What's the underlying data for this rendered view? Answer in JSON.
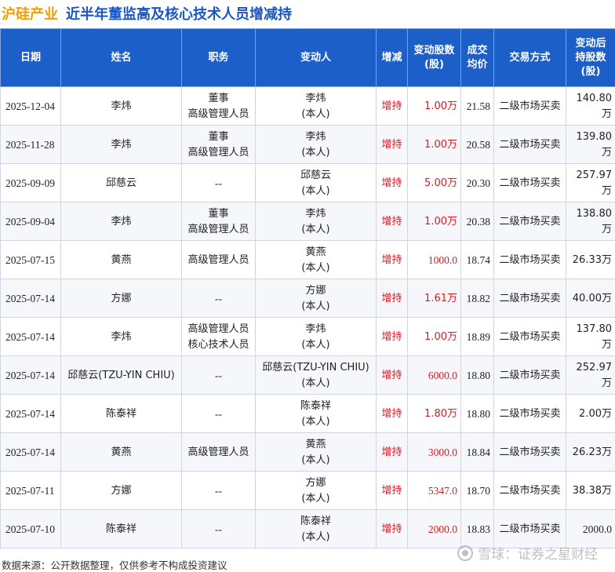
{
  "header": {
    "company": "沪硅产业",
    "subject": "近半年董监高及核心技术人员增减持"
  },
  "table": {
    "columns": [
      "日期",
      "姓名",
      "职务",
      "变动人",
      "增减",
      "变动股数\n(股)",
      "成交\n均价",
      "交易方式",
      "变动后\n持股数\n(股)"
    ],
    "rows": [
      {
        "date": "2025-12-04",
        "name": "李炜",
        "title1": "董事",
        "title2": "高级管理人员",
        "person1": "李炜",
        "person2": "(本人)",
        "dir": "增持",
        "shares": "1.00万",
        "price": "21.58",
        "method": "二级市场买卖",
        "after": "140.80万"
      },
      {
        "date": "2025-11-28",
        "name": "李炜",
        "title1": "董事",
        "title2": "高级管理人员",
        "person1": "李炜",
        "person2": "(本人)",
        "dir": "增持",
        "shares": "1.00万",
        "price": "20.58",
        "method": "二级市场买卖",
        "after": "139.80万"
      },
      {
        "date": "2025-09-09",
        "name": "邱慈云",
        "title1": "--",
        "title2": "",
        "person1": "邱慈云",
        "person2": "(本人)",
        "dir": "增持",
        "shares": "5.00万",
        "price": "20.30",
        "method": "二级市场买卖",
        "after": "257.97万"
      },
      {
        "date": "2025-09-04",
        "name": "李炜",
        "title1": "董事",
        "title2": "高级管理人员",
        "person1": "李炜",
        "person2": "(本人)",
        "dir": "增持",
        "shares": "1.00万",
        "price": "20.38",
        "method": "二级市场买卖",
        "after": "138.80万"
      },
      {
        "date": "2025-07-15",
        "name": "黄燕",
        "title1": "高级管理人员",
        "title2": "",
        "person1": "黄燕",
        "person2": "(本人)",
        "dir": "增持",
        "shares": "1000.0",
        "price": "18.74",
        "method": "二级市场买卖",
        "after": "26.33万"
      },
      {
        "date": "2025-07-14",
        "name": "方娜",
        "title1": "--",
        "title2": "",
        "person1": "方娜",
        "person2": "(本人)",
        "dir": "增持",
        "shares": "1.61万",
        "price": "18.82",
        "method": "二级市场买卖",
        "after": "40.00万"
      },
      {
        "date": "2025-07-14",
        "name": "李炜",
        "title1": "高级管理人员",
        "title2": "核心技术人员",
        "person1": "李炜",
        "person2": "(本人)",
        "dir": "增持",
        "shares": "1.00万",
        "price": "18.89",
        "method": "二级市场买卖",
        "after": "137.80万"
      },
      {
        "date": "2025-07-14",
        "name": "邱慈云(TZU-YIN CHIU)",
        "title1": "--",
        "title2": "",
        "person1": "邱慈云(TZU-YIN CHIU)",
        "person2": "(本人)",
        "dir": "增持",
        "shares": "6000.0",
        "price": "18.80",
        "method": "二级市场买卖",
        "after": "252.97万"
      },
      {
        "date": "2025-07-14",
        "name": "陈泰祥",
        "title1": "--",
        "title2": "",
        "person1": "陈泰祥",
        "person2": "(本人)",
        "dir": "增持",
        "shares": "1.80万",
        "price": "18.80",
        "method": "二级市场买卖",
        "after": "2.00万"
      },
      {
        "date": "2025-07-14",
        "name": "黄燕",
        "title1": "高级管理人员",
        "title2": "",
        "person1": "黄燕",
        "person2": "(本人)",
        "dir": "增持",
        "shares": "3000.0",
        "price": "18.84",
        "method": "二级市场买卖",
        "after": "26.23万"
      },
      {
        "date": "2025-07-11",
        "name": "方娜",
        "title1": "--",
        "title2": "",
        "person1": "方娜",
        "person2": "(本人)",
        "dir": "增持",
        "shares": "5347.0",
        "price": "18.70",
        "method": "二级市场买卖",
        "after": "38.38万"
      },
      {
        "date": "2025-07-10",
        "name": "陈泰祥",
        "title1": "--",
        "title2": "",
        "person1": "陈泰祥",
        "person2": "(本人)",
        "dir": "增持",
        "shares": "2000.0",
        "price": "18.83",
        "method": "二级市场买卖",
        "after": "2000.0"
      }
    ]
  },
  "footer": {
    "source": "数据来源：公开数据整理，仅供参考不构成投资建议",
    "logo_text": "雪球：证券之星财经"
  },
  "watermark": {
    "text": "证券之星"
  },
  "colors": {
    "header_bg": "#1d5fc9",
    "company": "#f0a000",
    "subject": "#1a56c4",
    "increase": "#e8141d"
  }
}
